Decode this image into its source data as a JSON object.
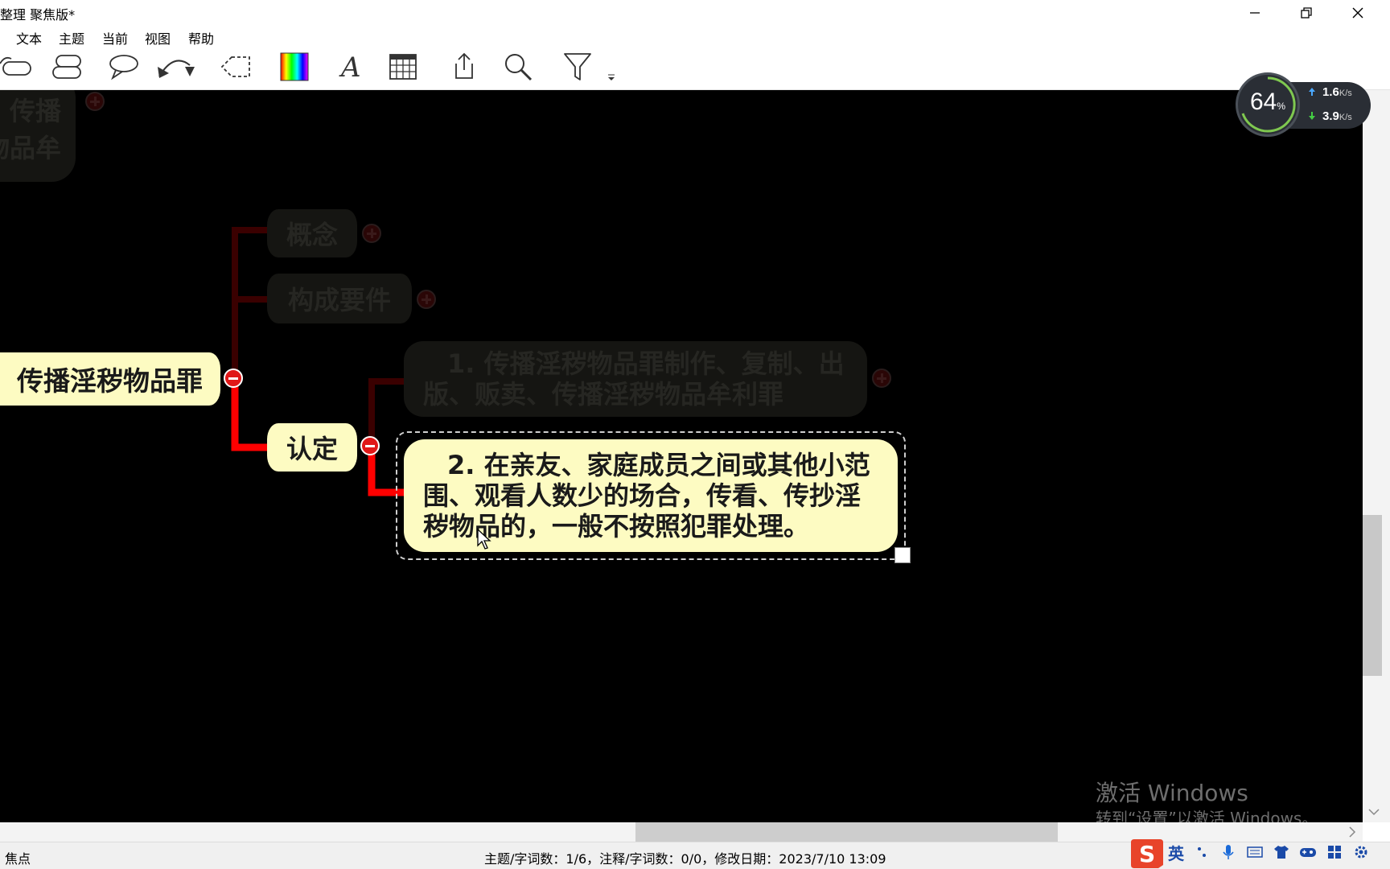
{
  "window": {
    "title": "整理 聚焦版*"
  },
  "menu": [
    "文本",
    "主题",
    "当前",
    "视图",
    "帮助"
  ],
  "nodes": {
    "topleft_line1": "传播",
    "topleft_line2": "物品牟",
    "concept": "概念",
    "elements": "构成要件",
    "central": "传播淫秽物品罪",
    "identify": "认定",
    "item1_line1": "1. 传播淫秽物品罪制作、复制、出",
    "item1_line2": "版、贩卖、传播淫秽物品牟利罪",
    "item2_line1": "2. 在亲友、家庭成员之间或其他小范",
    "item2_line2": "围、观看人数少的场合，传看、传抄淫",
    "item2_line3": "秽物品的，一般不按照犯罪处理。"
  },
  "status": {
    "mode": "焦点",
    "info": "主题/字词数：1/6，注释/字词数：0/0，修改日期：2023/7/10 13:09"
  },
  "watermark": {
    "line1": "激活 Windows",
    "line2": "转到“设置”以激活 Windows。"
  },
  "speed_widget": {
    "percent": "64",
    "percent_unit": "%",
    "upload": "1.6",
    "download": "3.9",
    "unit": "K/s"
  },
  "tray": {
    "ime": "英"
  },
  "colors": {
    "canvas": "#000000",
    "node_fill": "#fdfbc2",
    "connector": "#ff0000",
    "faded_connector": "#3a0000"
  }
}
